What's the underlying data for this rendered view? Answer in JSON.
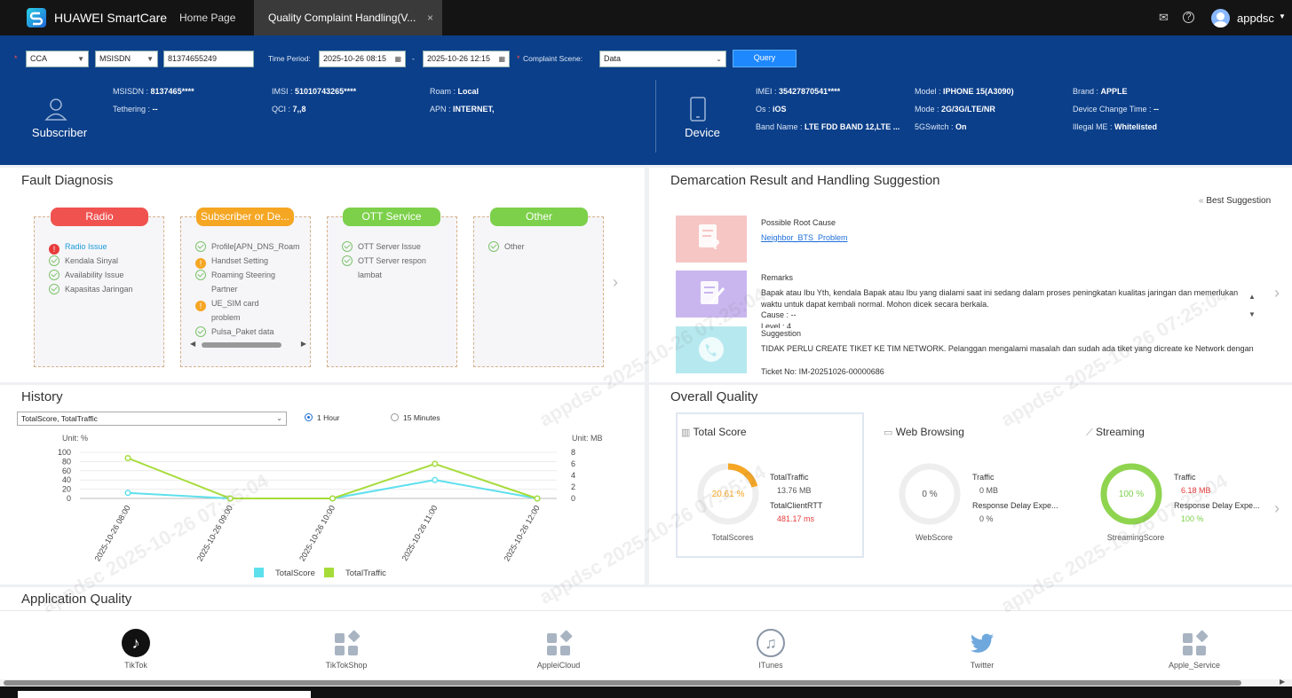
{
  "app": {
    "brand": "HUAWEI SmartCare",
    "tabs": [
      {
        "label": "Home Page"
      },
      {
        "label": "Quality Complaint Handling(V..."
      }
    ],
    "user": "appdsc",
    "close": "×"
  },
  "query": {
    "account": "CCA",
    "id_type": "MSISDN",
    "id_value": "81374655249",
    "time_label": "Time Period:",
    "time_start": "2025-10-26 08:15",
    "time_end": "2025-10-26 12:15",
    "scene_label": "Complaint Scene:",
    "scene_value": "Data",
    "button": "Query"
  },
  "subscriber": {
    "title": "Subscriber",
    "msisdn_k": "MSISDN :",
    "msisdn_v": "8137465****",
    "imsi_k": "IMSI :",
    "imsi_v": "51010743265****",
    "roam_k": "Roam :",
    "roam_v": "Local",
    "tether_k": "Tethering :",
    "tether_v": "--",
    "qci_k": "QCI :",
    "qci_v": "7,,8",
    "apn_k": "APN :",
    "apn_v": "INTERNET,"
  },
  "device": {
    "title": "Device",
    "imei_k": "IMEI :",
    "imei_v": "35427870541****",
    "model_k": "Model :",
    "model_v": "IPHONE 15(A3090)",
    "brand_k": "Brand :",
    "brand_v": "APPLE",
    "os_k": "Os :",
    "os_v": "iOS",
    "mode_k": "Mode :",
    "mode_v": "2G/3G/LTE/NR",
    "dct_k": "Device Change Time :",
    "dct_v": "--",
    "band_k": "Band Name :",
    "band_v": "LTE FDD BAND 12,LTE ...",
    "fivegs_k": "5GSwitch :",
    "fivegs_v": "On",
    "illegal_k": "Illegal ME :",
    "illegal_v": "Whitelisted"
  },
  "fault": {
    "title": "Fault Diagnosis",
    "cards": [
      {
        "head": "Radio",
        "color": "#f0524f",
        "items": [
          {
            "t": "Radio Issue",
            "s": "error"
          },
          {
            "t": "Kendala Sinyal",
            "s": "ok"
          },
          {
            "t": "Availability Issue",
            "s": "ok"
          },
          {
            "t": "Kapasitas Jaringan",
            "s": "ok"
          }
        ]
      },
      {
        "head": "Subscriber or De...",
        "color": "#f5a623",
        "items": [
          {
            "t": "Profile[APN_DNS_Roam",
            "s": "ok"
          },
          {
            "t": "Handset Setting",
            "s": "warn"
          },
          {
            "t": "Roaming Steering",
            "s": "ok"
          },
          {
            "t": "Partner",
            "s": "none"
          },
          {
            "t": "UE_SIM card",
            "s": "warn"
          },
          {
            "t": "problem",
            "s": "none"
          },
          {
            "t": "Pulsa_Paket data",
            "s": "ok"
          }
        ]
      },
      {
        "head": "OTT Service",
        "color": "#7cd04a",
        "items": [
          {
            "t": "OTT Server Issue",
            "s": "ok"
          },
          {
            "t": "OTT Server respon",
            "s": "ok"
          },
          {
            "t": "lambat",
            "s": "none"
          }
        ]
      },
      {
        "head": "Other",
        "color": "#7cd04a",
        "items": [
          {
            "t": "Other",
            "s": "ok"
          }
        ]
      }
    ]
  },
  "demarcation": {
    "title": "Demarcation Result and Handling Suggestion",
    "best": "Best Suggestion",
    "root_label": "Possible Root Cause",
    "root_value": "Neighbor_BTS_Problem",
    "remarks_label": "Remarks",
    "remarks_text": "Bapak atau Ibu Yth, kendala Bapak atau Ibu yang dialami saat ini sedang dalam proses peningkatan kualitas jaringan dan memerlukan waktu untuk dapat kembali normal. Mohon dicek secara berkala.",
    "remarks_cause": "Cause : --",
    "remarks_level": "Level : 4",
    "suggestion_label": "Suggestion",
    "suggestion_text": "TIDAK PERLU CREATE TIKET KE TIM NETWORK. Pelanggan mengalami masalah dan sudah ada tiket yang dicreate ke Network dengan",
    "ticket": "Ticket No: IM-20251026-00000686"
  },
  "history": {
    "title": "History",
    "select": "TotalScore, TotalTraffic",
    "radio1": "1 Hour",
    "radio2": "15 Minutes",
    "unit_left": "Unit: %",
    "unit_right": "Unit: MB"
  },
  "chart_data": {
    "type": "line",
    "x": [
      "2025-10-26 08:00",
      "2025-10-26 09:00",
      "2025-10-26 10:00",
      "2025-10-26 11:00",
      "2025-10-26 12:00"
    ],
    "y_left": [
      0,
      20,
      40,
      60,
      80,
      100
    ],
    "y_right": [
      0,
      2,
      4,
      6,
      8
    ],
    "ylim_left": [
      0,
      100
    ],
    "ylim_right": [
      0,
      8
    ],
    "series": [
      {
        "name": "TotalScore",
        "axis": "left",
        "color": "#5ee0ec",
        "values": [
          12,
          0,
          0,
          40,
          0
        ]
      },
      {
        "name": "TotalTraffic",
        "axis": "right",
        "color": "#a6dc3a",
        "values": [
          7,
          0,
          0,
          6,
          0
        ]
      }
    ]
  },
  "overall": {
    "title": "Overall Quality",
    "total": {
      "label": "Total Score",
      "pct": "20.61 %",
      "value": 0.2061,
      "k1": "TotalTraffic",
      "v1": "13.76 MB",
      "k2": "TotalClientRTT",
      "v2": "481.17 ms",
      "caption": "TotalScores"
    },
    "web": {
      "label": "Web Browsing",
      "pct": "0 %",
      "value": 0,
      "k1": "Traffic",
      "v1": "0 MB",
      "k2": "Response Delay Expe...",
      "v2": "0 %",
      "caption": "WebScore"
    },
    "stream": {
      "label": "Streaming",
      "pct": "100 %",
      "value": 1,
      "k1": "Traffic",
      "v1": "6.18 MB",
      "k2": "Response Delay Expe...",
      "v2": "100 %",
      "caption": "StreamingScore"
    }
  },
  "apps": {
    "title": "Application Quality",
    "items": [
      {
        "name": "TikTok"
      },
      {
        "name": "TikTokShop"
      },
      {
        "name": "AppleiCloud"
      },
      {
        "name": "ITunes"
      },
      {
        "name": "Twitter"
      },
      {
        "name": "Apple_Service"
      }
    ]
  },
  "watermark": "appdsc 2025-10-26 07:25:04"
}
